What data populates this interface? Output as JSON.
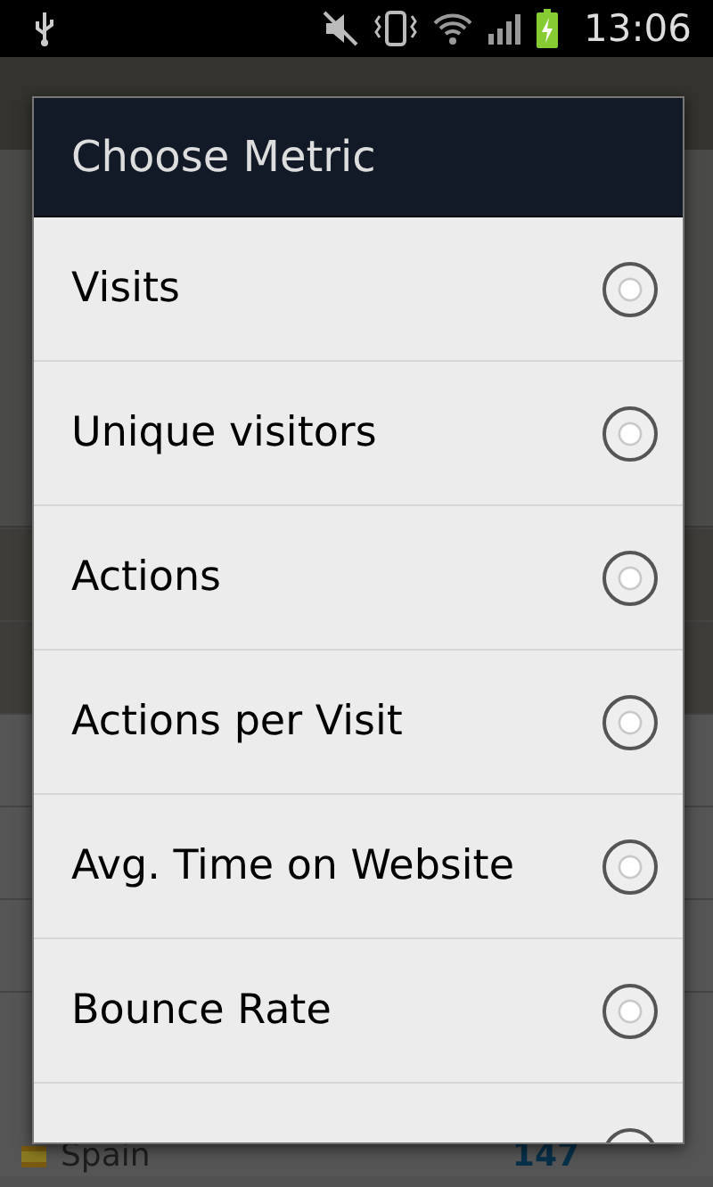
{
  "status_bar": {
    "time": "13:06"
  },
  "background": {
    "row": {
      "label": "Spain",
      "value": "147"
    }
  },
  "dialog": {
    "title": "Choose Metric",
    "options": [
      {
        "label": "Visits",
        "selected": false
      },
      {
        "label": "Unique visitors",
        "selected": false
      },
      {
        "label": "Actions",
        "selected": false
      },
      {
        "label": "Actions per Visit",
        "selected": false
      },
      {
        "label": "Avg. Time on Website",
        "selected": false
      },
      {
        "label": "Bounce Rate",
        "selected": false
      }
    ],
    "cut_option": {
      "selected": false
    }
  }
}
